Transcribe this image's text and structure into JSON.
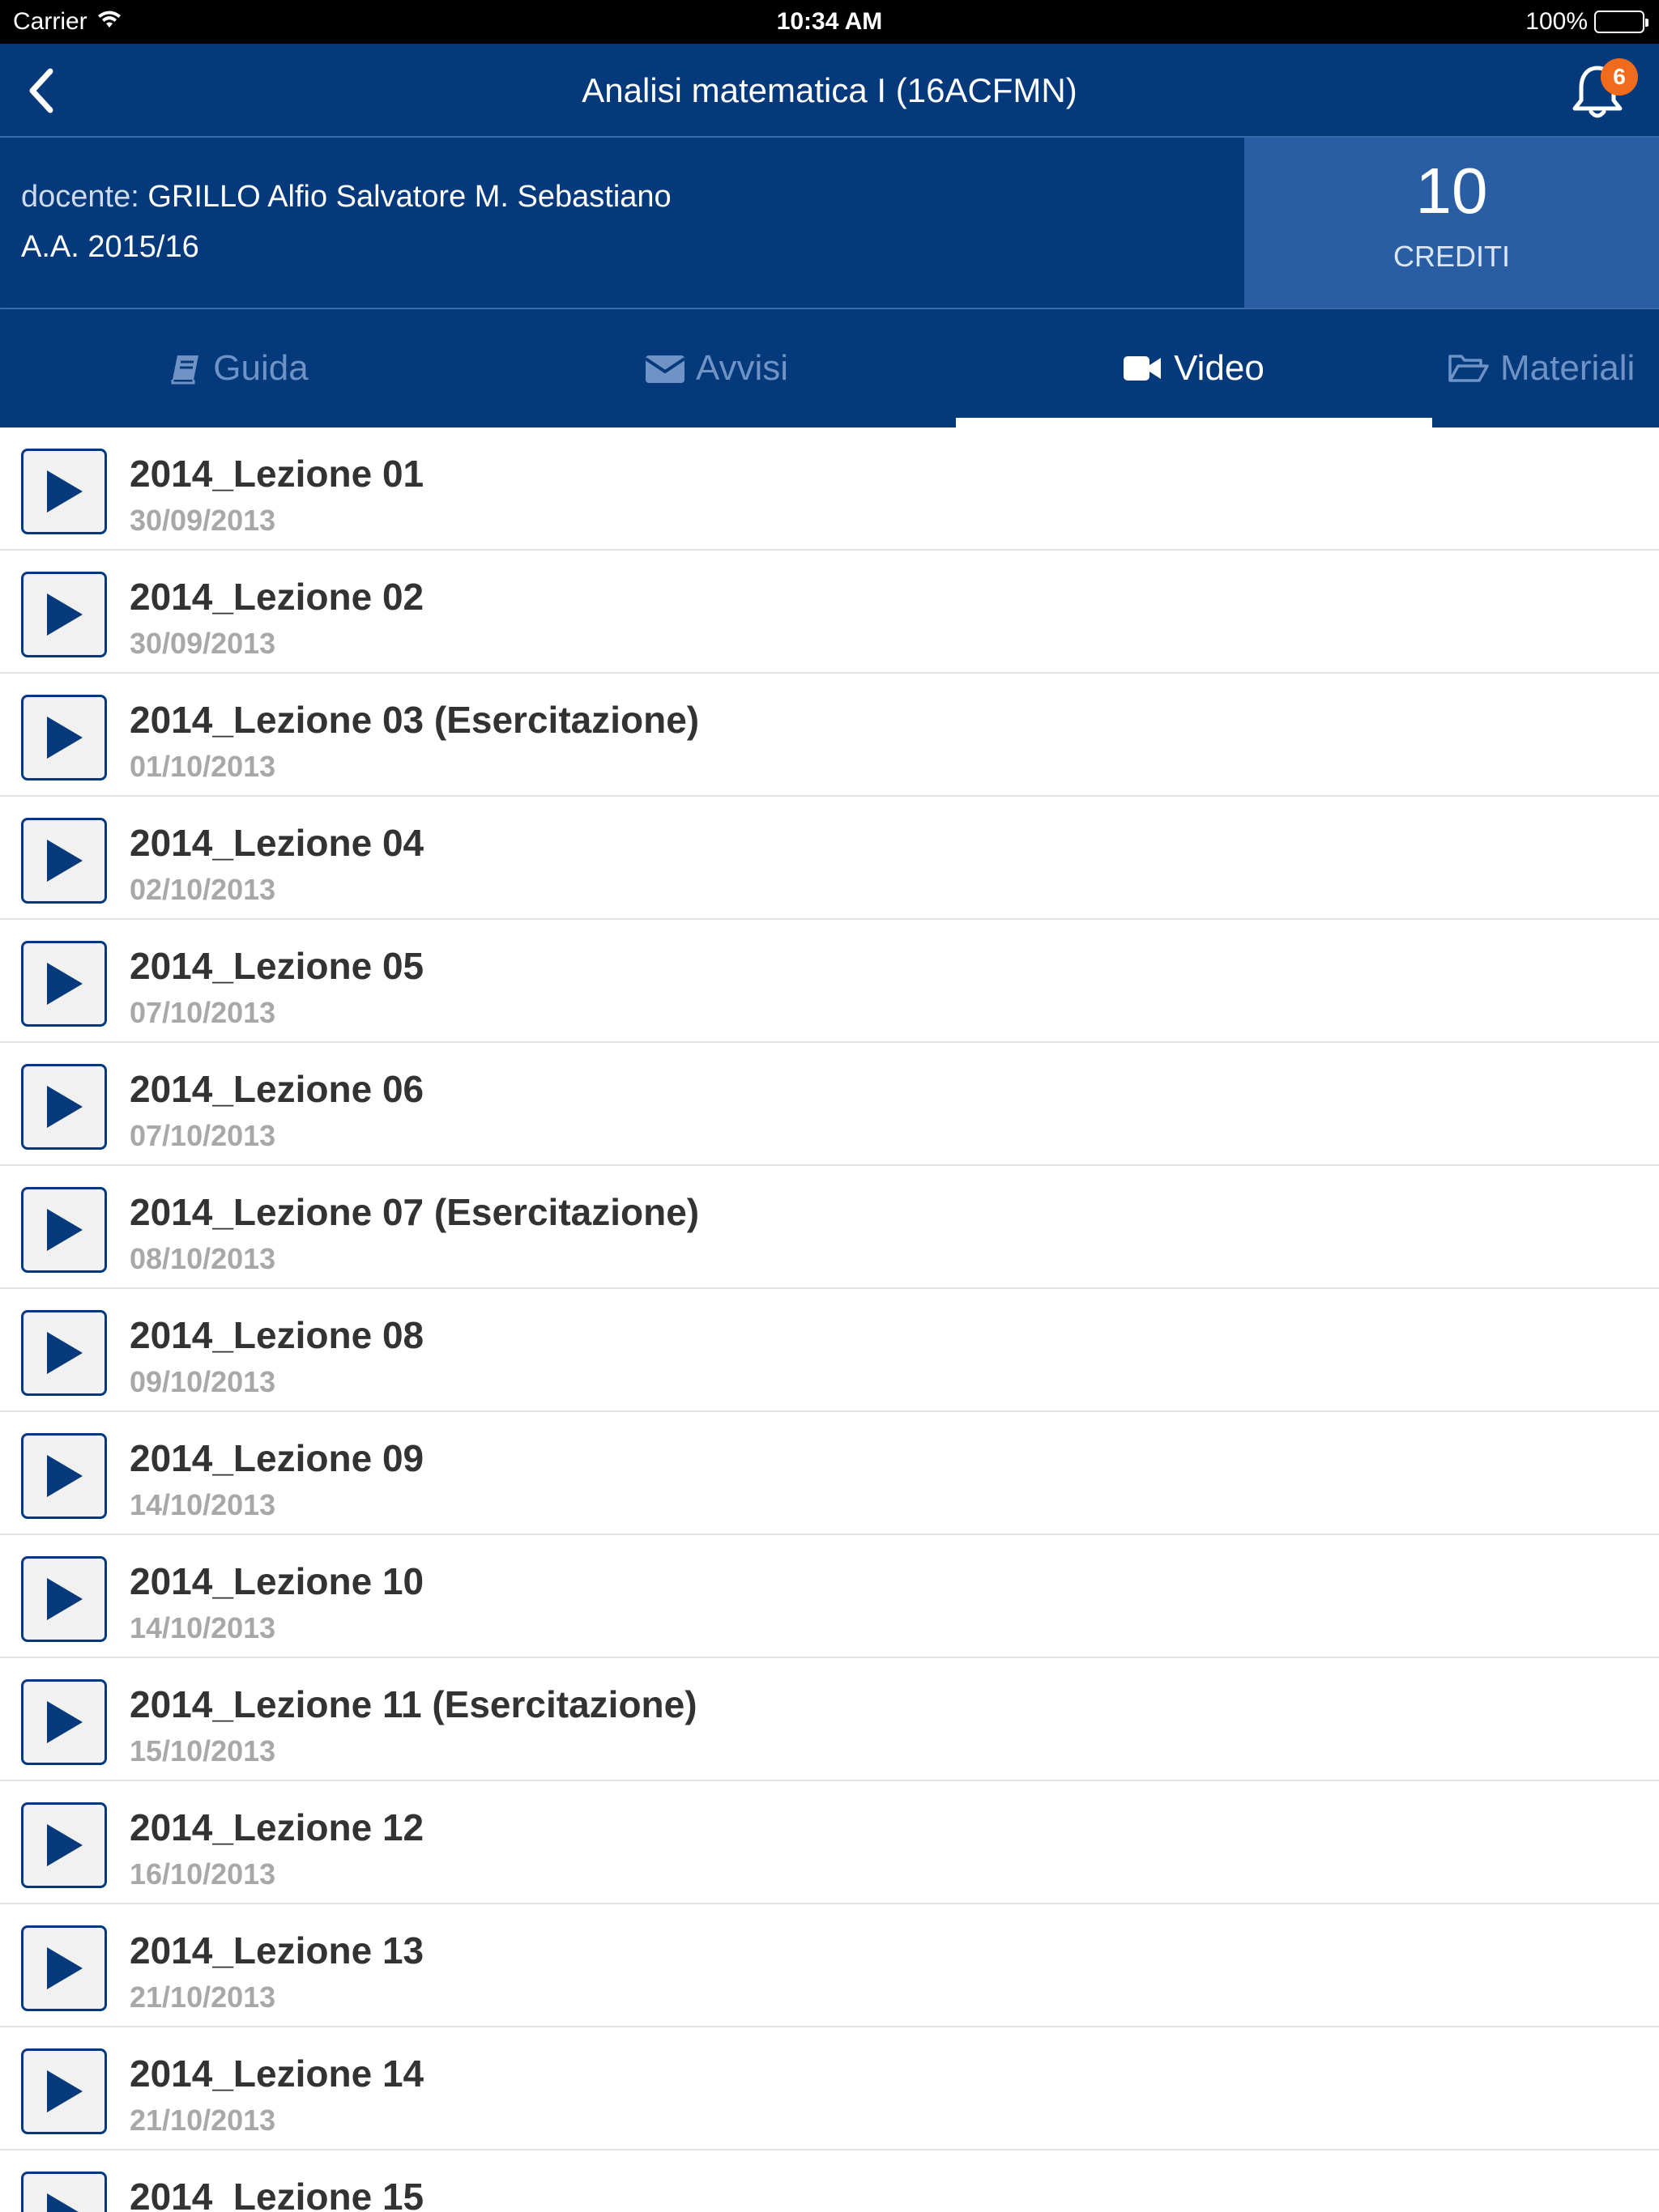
{
  "status_bar": {
    "carrier": "Carrier",
    "time": "10:34 AM",
    "battery": "100%"
  },
  "nav": {
    "title": "Analisi matematica I (16ACFMN)",
    "notification_count": "6"
  },
  "course": {
    "teacher_label": "docente:",
    "teacher_name": "GRILLO Alfio Salvatore M. Sebastiano",
    "year": "A.A. 2015/16",
    "credits_value": "10",
    "credits_label": "CREDITI"
  },
  "tabs": [
    {
      "label": "Guida",
      "icon": "book-icon",
      "active": false
    },
    {
      "label": "Avvisi",
      "icon": "envelope-icon",
      "active": false
    },
    {
      "label": "Video",
      "icon": "video-camera-icon",
      "active": true
    },
    {
      "label": "Materiali",
      "icon": "folder-open-icon",
      "active": false
    }
  ],
  "videos": [
    {
      "title": "2014_Lezione 01",
      "date": "30/09/2013"
    },
    {
      "title": "2014_Lezione 02",
      "date": "30/09/2013"
    },
    {
      "title": "2014_Lezione 03 (Esercitazione)",
      "date": "01/10/2013"
    },
    {
      "title": "2014_Lezione 04",
      "date": "02/10/2013"
    },
    {
      "title": "2014_Lezione 05",
      "date": "07/10/2013"
    },
    {
      "title": "2014_Lezione 06",
      "date": "07/10/2013"
    },
    {
      "title": "2014_Lezione 07 (Esercitazione)",
      "date": "08/10/2013"
    },
    {
      "title": "2014_Lezione 08",
      "date": "09/10/2013"
    },
    {
      "title": "2014_Lezione 09",
      "date": "14/10/2013"
    },
    {
      "title": "2014_Lezione 10",
      "date": "14/10/2013"
    },
    {
      "title": "2014_Lezione 11 (Esercitazione)",
      "date": "15/10/2013"
    },
    {
      "title": "2014_Lezione 12",
      "date": "16/10/2013"
    },
    {
      "title": "2014_Lezione 13",
      "date": "21/10/2013"
    },
    {
      "title": "2014_Lezione 14",
      "date": "21/10/2013"
    },
    {
      "title": "2014_Lezione 15",
      "date": ""
    }
  ],
  "colors": {
    "primary": "#04397b",
    "credits_bg": "#2a5ea4",
    "badge": "#f26a1b",
    "inactive_tab": "#6f93c4"
  }
}
